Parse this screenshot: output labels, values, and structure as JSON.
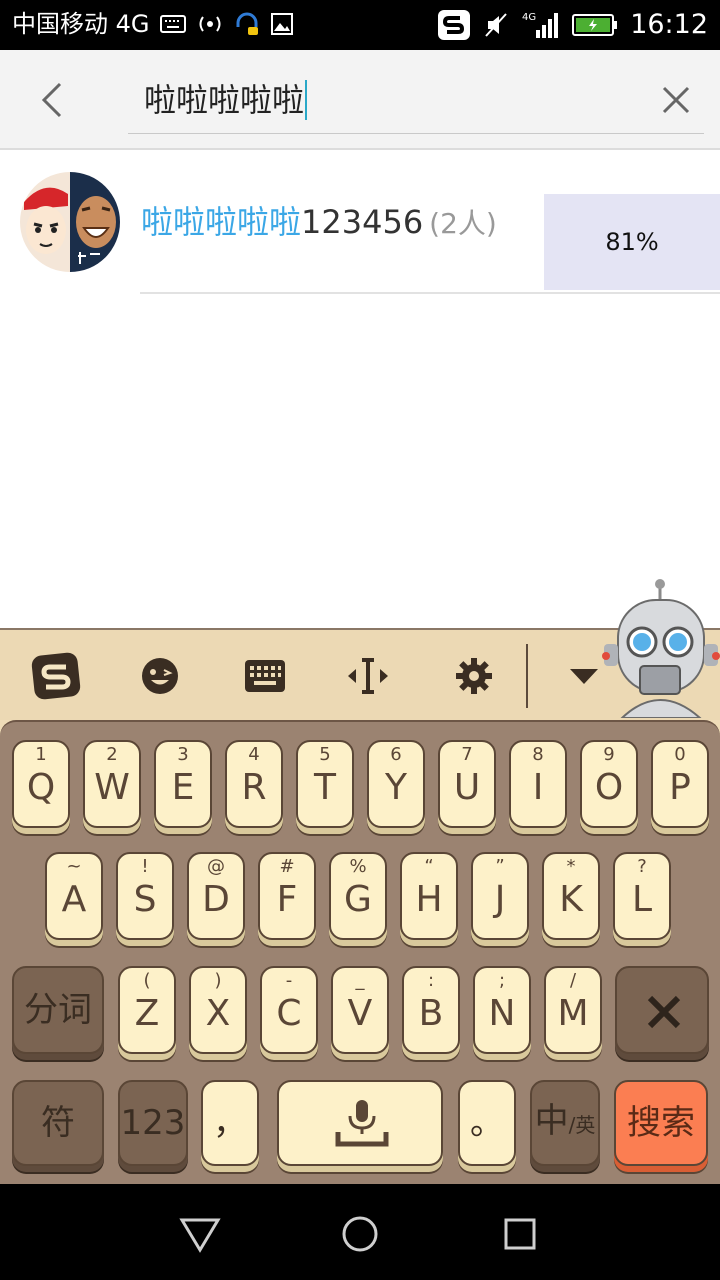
{
  "status_bar": {
    "carrier": "中国移动 4G",
    "network": "4G",
    "time": "16:12",
    "icons": [
      "keyboard-icon",
      "wifi-hotspot-icon",
      "headset-icon",
      "image-icon",
      "sogou-icon",
      "mute-icon",
      "signal-icon",
      "battery-icon"
    ]
  },
  "search": {
    "query": "啦啦啦啦啦",
    "back_icon": "chevron-left-icon",
    "clear_icon": "close-icon"
  },
  "results": [
    {
      "name_highlight": "啦啦啦啦啦",
      "name_rest": "123456",
      "member_count": "(2人)",
      "match_percent": "81%"
    }
  ],
  "keyboard": {
    "toolbar_icons": [
      "sogou-logo-icon",
      "emoji-icon",
      "keyboard-icon",
      "cursor-icon",
      "settings-icon",
      "collapse-icon"
    ],
    "row1": [
      {
        "top": "1",
        "main": "Q"
      },
      {
        "top": "2",
        "main": "W"
      },
      {
        "top": "3",
        "main": "E"
      },
      {
        "top": "4",
        "main": "R"
      },
      {
        "top": "5",
        "main": "T"
      },
      {
        "top": "6",
        "main": "Y"
      },
      {
        "top": "7",
        "main": "U"
      },
      {
        "top": "8",
        "main": "I"
      },
      {
        "top": "9",
        "main": "O"
      },
      {
        "top": "0",
        "main": "P"
      }
    ],
    "row2": [
      {
        "top": "~",
        "main": "A"
      },
      {
        "top": "!",
        "main": "S"
      },
      {
        "top": "@",
        "main": "D"
      },
      {
        "top": "#",
        "main": "F"
      },
      {
        "top": "%",
        "main": "G"
      },
      {
        "top": "“",
        "main": "H"
      },
      {
        "top": "”",
        "main": "J"
      },
      {
        "top": "*",
        "main": "K"
      },
      {
        "top": "?",
        "main": "L"
      }
    ],
    "row3": [
      {
        "top": "(",
        "main": "Z"
      },
      {
        "top": ")",
        "main": "X"
      },
      {
        "top": "-",
        "main": "C"
      },
      {
        "top": "_",
        "main": "V"
      },
      {
        "top": ":",
        "main": "B"
      },
      {
        "top": ";",
        "main": "N"
      },
      {
        "top": "/",
        "main": "M"
      }
    ],
    "segment_label": "分词",
    "symbol_label": "符",
    "number_label": "123",
    "comma_label": "，",
    "period_label": "。",
    "lang_main": "中",
    "lang_sub": "/英",
    "search_label": "搜索",
    "voice_icon": "microphone-icon",
    "delete_icon": "delete-icon"
  },
  "nav_bar": {
    "icons": [
      "back-triangle-icon",
      "home-circle-icon",
      "recents-square-icon"
    ]
  },
  "colors": {
    "highlight": "#3ba7e6",
    "keycap": "#fdf1c9",
    "keyboard_body": "#9b8371",
    "search_key": "#fb7e52",
    "percent_box": "#e4e4f4"
  }
}
